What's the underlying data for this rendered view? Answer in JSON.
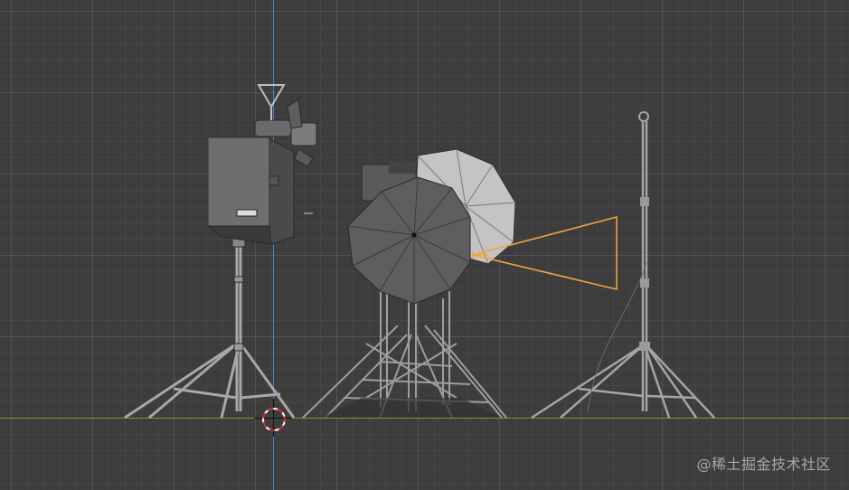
{
  "viewport": {
    "background_color": "#3d3d3d",
    "grid_color": "#5a5a5a",
    "axis_z_color": "#4f7ec4",
    "axis_x_color": "#7a9a2e",
    "selection_color": "#f3a43a"
  },
  "objects": [
    {
      "name": "softbox-light",
      "icon": "softbox"
    },
    {
      "name": "umbrella-light-black",
      "icon": "umbrella"
    },
    {
      "name": "umbrella-light-white",
      "icon": "umbrella"
    },
    {
      "name": "light-stand-tall",
      "icon": "light-stand"
    },
    {
      "name": "selected-camera",
      "icon": "camera-frustum"
    }
  ],
  "watermark": "@稀土掘金技术社区"
}
